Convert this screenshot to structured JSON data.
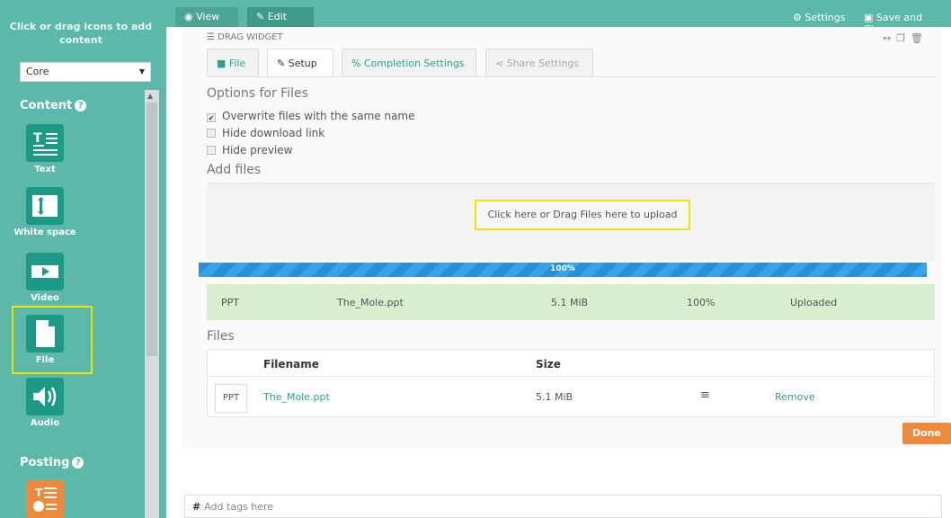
{
  "sidebar": {
    "hint": "Click or drag icons to add content",
    "category_select": "Core",
    "sections": [
      {
        "title": "Content"
      },
      {
        "title": "Posting"
      }
    ],
    "tools": [
      {
        "label": "Text",
        "icon": "text-icon"
      },
      {
        "label": "White space",
        "icon": "whitespace-icon"
      },
      {
        "label": "Video",
        "icon": "video-icon"
      },
      {
        "label": "File",
        "icon": "file-icon"
      },
      {
        "label": "Audio",
        "icon": "audio-icon"
      }
    ]
  },
  "topbar": {
    "view_label": "View",
    "edit_label": "Edit",
    "settings_label": "Settings",
    "save_label": "Save and Close"
  },
  "widget": {
    "drag_label": "DRAG WIDGET",
    "tabs": [
      {
        "label": "File"
      },
      {
        "label": "Setup",
        "active": true
      },
      {
        "label": "Completion Settings"
      },
      {
        "label": "Share Settings",
        "disabled": true
      }
    ],
    "options_title": "Options for Files",
    "options": [
      {
        "label": "Overwrite files with the same name",
        "checked": true
      },
      {
        "label": "Hide download link",
        "checked": false
      },
      {
        "label": "Hide preview",
        "checked": false
      }
    ],
    "add_files_title": "Add files",
    "dropzone_text": "Click here or Drag Files here to upload",
    "progress": {
      "value": 1.0,
      "label": "100%"
    },
    "upload_row": {
      "type": "PPT",
      "name": "The_Mole.ppt",
      "size": "5.1 MiB",
      "percent": "100%",
      "status": "Uploaded"
    },
    "files_title": "Files",
    "table": {
      "headers": {
        "filename": "Filename",
        "size": "Size"
      },
      "rows": [
        {
          "type": "PPT",
          "filename": "The_Mole.ppt",
          "size": "5.1 MiB",
          "handle": "≡",
          "action": "Remove"
        }
      ]
    },
    "done_label": "Done"
  },
  "tags": {
    "symbol": "#",
    "placeholder": "Add tags here"
  },
  "colors": {
    "sidebar": "#5cb8a8",
    "icon_bg": "#1d9a87",
    "highlight": "#f2e400",
    "progress": "#2a8fd6",
    "done": "#ee8a3c",
    "upload_row": "#d9edcf"
  }
}
